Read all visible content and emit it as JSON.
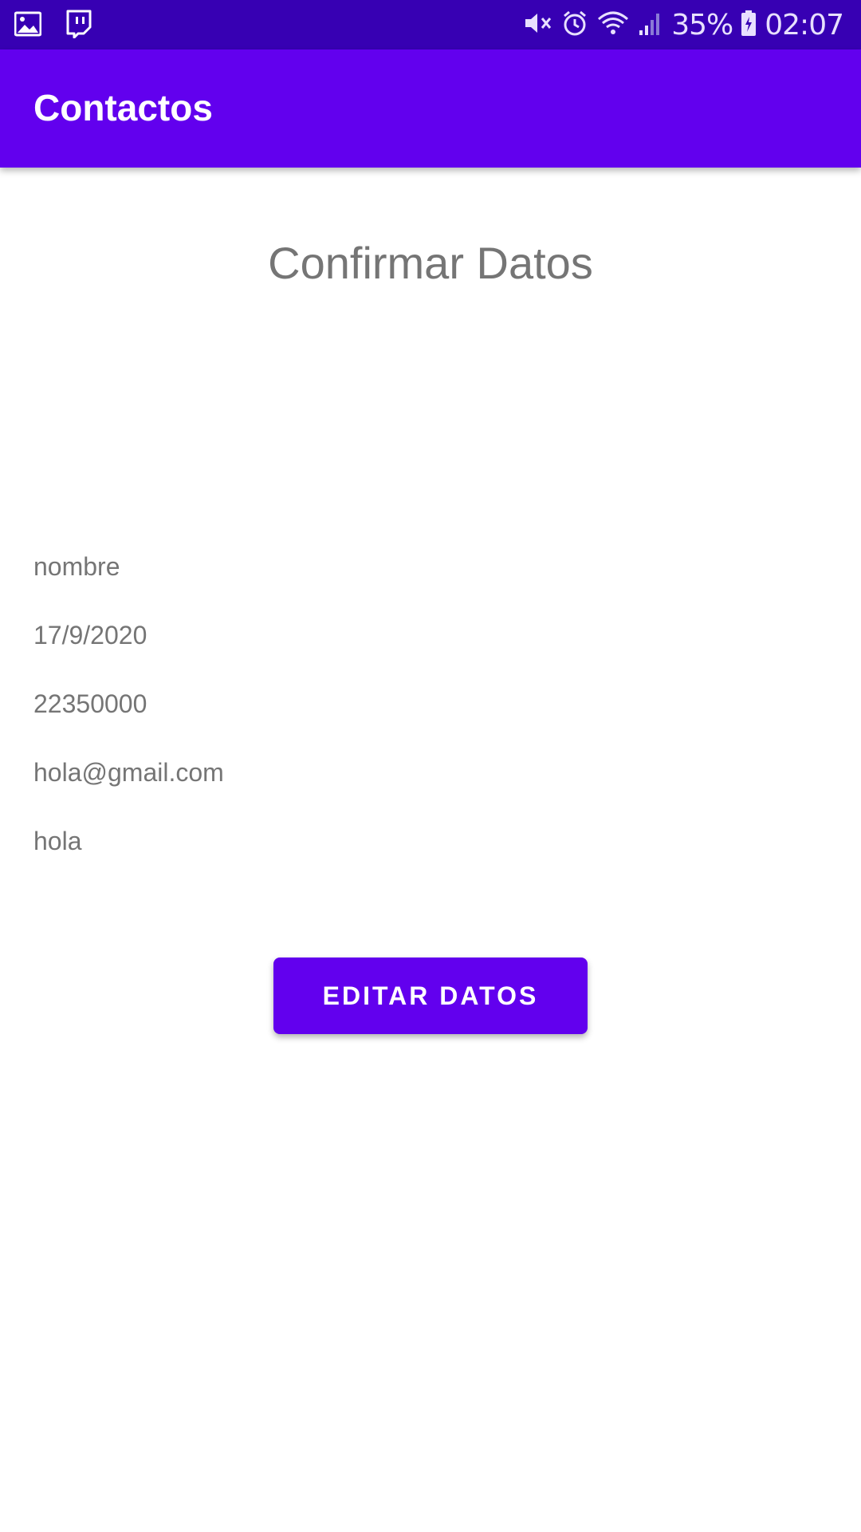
{
  "status_bar": {
    "left_icons": [
      "image-icon",
      "twitch-icon"
    ],
    "right_icons": [
      "mute-icon",
      "alarm-icon",
      "wifi-icon",
      "signal-icon"
    ],
    "battery_percent": "35%",
    "time": "02:07"
  },
  "app_bar": {
    "title": "Contactos",
    "color": "#6200ee"
  },
  "main": {
    "heading": "Confirmar Datos",
    "fields": {
      "nombre": "nombre",
      "fecha": "17/9/2020",
      "telefono": "22350000",
      "email": "hola@gmail.com",
      "descripcion": "hola"
    },
    "edit_button_label": "EDITAR DATOS"
  },
  "colors": {
    "status_bar": "#3700b3",
    "primary": "#6200ee",
    "text_secondary": "#757575"
  }
}
